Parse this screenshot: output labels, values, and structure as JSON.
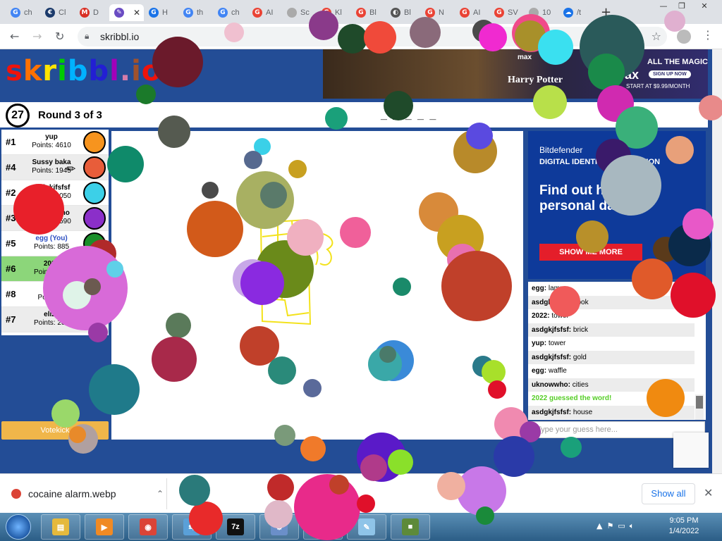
{
  "tabs": [
    {
      "label": "ch",
      "favicon": "G",
      "color": "#4285f4"
    },
    {
      "label": "Cl",
      "favicon": "€",
      "color": "#1b3a6b"
    },
    {
      "label": "D",
      "favicon": "M",
      "color": "#d93025"
    },
    {
      "label": "",
      "favicon": "✎",
      "color": "#6a4cc3",
      "active": true
    },
    {
      "label": "H",
      "favicon": "G",
      "color": "#1a73e8"
    },
    {
      "label": "th",
      "favicon": "G",
      "color": "#4285f4"
    },
    {
      "label": "ch",
      "favicon": "G",
      "color": "#4285f4"
    },
    {
      "label": "AI",
      "favicon": "G",
      "color": "#ea4335"
    },
    {
      "label": "Sc",
      "favicon": "",
      "color": "#aaaaaa"
    },
    {
      "label": "Kl",
      "favicon": "G",
      "color": "#ea4335"
    },
    {
      "label": "Bl",
      "favicon": "G",
      "color": "#ea4335"
    },
    {
      "label": "Bl",
      "favicon": "◐",
      "color": "#555555"
    },
    {
      "label": "N",
      "favicon": "G",
      "color": "#ea4335"
    },
    {
      "label": "AI",
      "favicon": "G",
      "color": "#ea4335"
    },
    {
      "label": "SV",
      "favicon": "G",
      "color": "#ea4335"
    },
    {
      "label": "10",
      "favicon": "",
      "color": "#aaaaaa"
    },
    {
      "label": "/t",
      "favicon": "☁",
      "color": "#1a73e8"
    }
  ],
  "browser": {
    "url": "skribbl.io",
    "new_tab": "+",
    "min": "—",
    "max": "❐",
    "close": "✕"
  },
  "logo": {
    "parts": [
      "s",
      "k",
      "r",
      "i",
      "b",
      "b",
      "l",
      ".",
      "i",
      "o",
      "!"
    ]
  },
  "top_ad": {
    "brand": "max",
    "title": "Harry Potter",
    "tagline": "ALL THE MAGIC",
    "cta": "SIGN UP NOW",
    "suffix": "ax",
    "offer": "START AT $9.99/MONTH"
  },
  "game": {
    "timer": "27",
    "round": "Round 3 of 3",
    "word_hint": "_ _ _ _ _"
  },
  "players": [
    {
      "rank": "#1",
      "name": "yup",
      "points": "Points: 4610",
      "avatar": "#f7941e",
      "state": ""
    },
    {
      "rank": "#4",
      "name": "Sussy baka",
      "points": "Points: 1945",
      "avatar": "#e85d3a",
      "state": "alt",
      "drawing": true
    },
    {
      "rank": "#2",
      "name": "asdgkjfsfsf",
      "points": "Points: 4050",
      "avatar": "#3cd0e8",
      "state": ""
    },
    {
      "rank": "#3",
      "name": "uknowwho",
      "points": "Points: 3590",
      "avatar": "#8b2fc9",
      "state": "alt"
    },
    {
      "rank": "#5",
      "name": "egg (You)",
      "points": "Points: 885",
      "avatar": "#1a8f2a",
      "state": "",
      "you": true
    },
    {
      "rank": "#6",
      "name": "2022",
      "points": "Points: 820",
      "avatar": "#9ab83c",
      "state": "drawing"
    },
    {
      "rank": "#8",
      "name": "",
      "points": "Points: 0",
      "avatar": "#e2b6d8",
      "state": ""
    },
    {
      "rank": "#7",
      "name": "eliza",
      "points": "Points: 205",
      "avatar": "#cc4444",
      "state": "alt"
    }
  ],
  "votekick": "Votekick",
  "side_ad": {
    "brand": "Bitdefender",
    "sub": "DIGITAL IDENTITY PROTECTION",
    "headline": "Find out has your personal data",
    "cta": "SHOW ME MORE"
  },
  "chat": [
    {
      "name": "egg",
      "text": "lamp",
      "state": ""
    },
    {
      "name": "asdgkjfsfsf",
      "text": "book",
      "state": "alt"
    },
    {
      "name": "2022",
      "text": "tower",
      "state": ""
    },
    {
      "name": "asdgkjfsfsf",
      "text": "brick",
      "state": "alt"
    },
    {
      "name": "yup",
      "text": "tower",
      "state": ""
    },
    {
      "name": "asdgkjfsfsf",
      "text": "gold",
      "state": "alt"
    },
    {
      "name": "egg",
      "text": "waffle",
      "state": ""
    },
    {
      "name": "uknowwho",
      "text": "cities",
      "state": "alt"
    },
    {
      "name": "",
      "text": "2022 guessed the word!",
      "state": "correct"
    },
    {
      "name": "asdgkjfsfsf",
      "text": "house",
      "state": "alt"
    }
  ],
  "guess_placeholder": "Type your guess here...",
  "download": {
    "filename": "cocaine alarm.webp",
    "show_all": "Show all",
    "close": "✕"
  },
  "taskbar": {
    "apps": [
      {
        "name": "explorer",
        "color": "#e5b93d",
        "glyph": "▤"
      },
      {
        "name": "media-player",
        "color": "#f08a24",
        "glyph": "▶"
      },
      {
        "name": "chrome",
        "color": "#db4437",
        "glyph": "◉"
      },
      {
        "name": "network",
        "color": "#5aa0d8",
        "glyph": "⇆"
      },
      {
        "name": "7zip",
        "color": "#111111",
        "glyph": "7z"
      },
      {
        "name": "installer",
        "color": "#6b8fc9",
        "glyph": "⚙"
      },
      {
        "name": "monitor",
        "color": "#3c7a3c",
        "glyph": "▦"
      },
      {
        "name": "notepad",
        "color": "#8fc4e8",
        "glyph": "✎"
      },
      {
        "name": "minecraft",
        "color": "#5d8a3a",
        "glyph": "■"
      }
    ],
    "time": "9:05 PM",
    "date": "1/4/2022"
  },
  "colors": {
    "page_bg": "#234d96",
    "drawing_row": "#8cd67a",
    "correct_text": "#56ce27",
    "votekick": "#f0b64a",
    "ad_cta": "#e41e2a"
  }
}
